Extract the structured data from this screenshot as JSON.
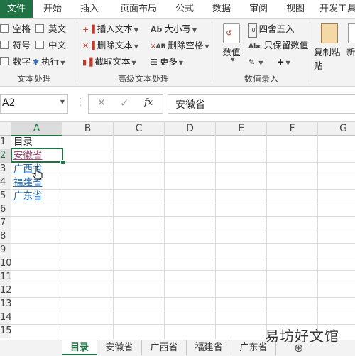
{
  "menu": {
    "file": "文件",
    "home": "开始",
    "insert": "插入",
    "layout": "页面布局",
    "formulas": "公式",
    "data": "数据",
    "review": "审阅",
    "view": "视图",
    "developer": "开发工具"
  },
  "ribbon": {
    "text_group": {
      "label": "文本处理",
      "options": [
        "空格",
        "英文",
        "符号",
        "中文",
        "数字"
      ],
      "execute": "执行"
    },
    "advanced_group": {
      "label": "高级文本处理",
      "insert_text": "插入文本",
      "delete_text": "删除文本",
      "extract_text": "截取文本",
      "case": "大小写",
      "delete_spaces": "删除空格",
      "more": "更多"
    },
    "value_group": {
      "label": "数值录入",
      "value": "数值",
      "round": "四舍五入",
      "keep_value": "只保留数值"
    },
    "paste": {
      "copy_paste": "复制粘贴",
      "new": "新"
    },
    "icon_text": {
      "ab": "Ab",
      "ab2": "AB",
      "abc": "Abc"
    }
  },
  "formula_bar": {
    "name_box": "A2",
    "fx": "fx",
    "content": "安徽省"
  },
  "grid": {
    "columns": [
      "A",
      "B",
      "C",
      "D",
      "E",
      "F",
      "G"
    ],
    "rows": [
      "1",
      "2",
      "3",
      "4",
      "5",
      "6",
      "7",
      "8",
      "9",
      "10",
      "11",
      "12",
      "13",
      "14",
      "15"
    ],
    "cells": {
      "a1": "目录",
      "a2": "安徽省",
      "a3": "广西省",
      "a4": "福建省",
      "a5": "广东省"
    }
  },
  "sheet_tabs": [
    "目录",
    "安徽省",
    "广西省",
    "福建省",
    "广东省"
  ],
  "watermark": "易坊好文馆",
  "colors": {
    "accent": "#217346",
    "link": "#2d6cb0",
    "visited": "#954f72"
  }
}
